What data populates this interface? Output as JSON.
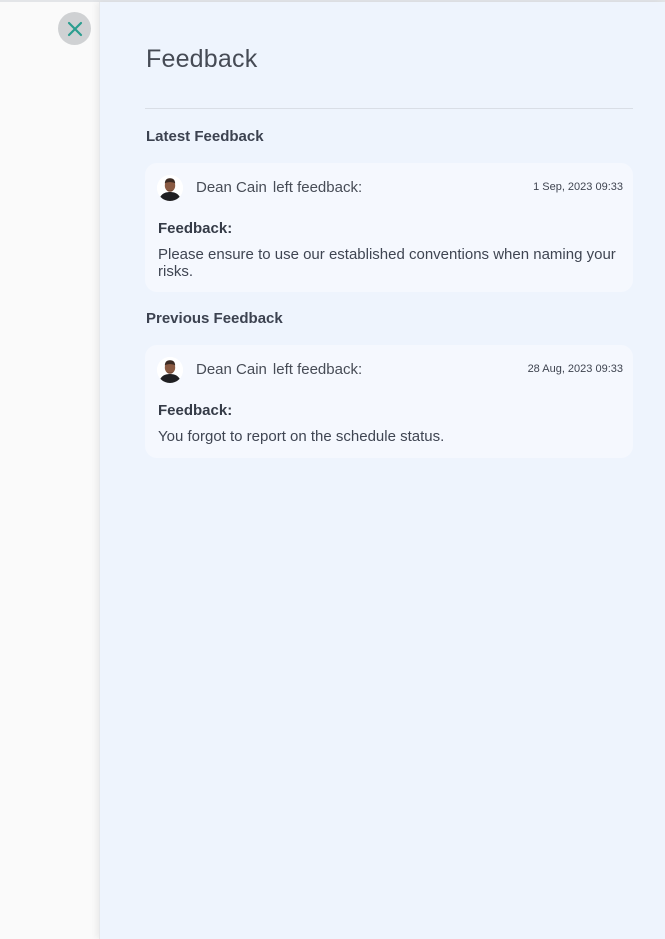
{
  "drawer": {
    "title": "Feedback",
    "close_icon": "close-icon"
  },
  "colors": {
    "panel_background": "#eef4fd",
    "card_background": "#f5f8fe",
    "close_icon": "#2a9d8f",
    "close_button_background": "#cfd1d3"
  },
  "latest": {
    "heading": "Latest Feedback",
    "author": "Dean Cain",
    "action": "left feedback:",
    "timestamp": "1 Sep, 2023 09:33",
    "label": "Feedback:",
    "text": "Please ensure to use our established conventions when naming your risks.",
    "avatar_icon": "user-avatar"
  },
  "previous": {
    "heading": "Previous Feedback",
    "author": "Dean Cain",
    "action": "left feedback:",
    "timestamp": "28 Aug, 2023 09:33",
    "label": "Feedback:",
    "text": "You forgot to report on the schedule status.",
    "avatar_icon": "user-avatar"
  }
}
